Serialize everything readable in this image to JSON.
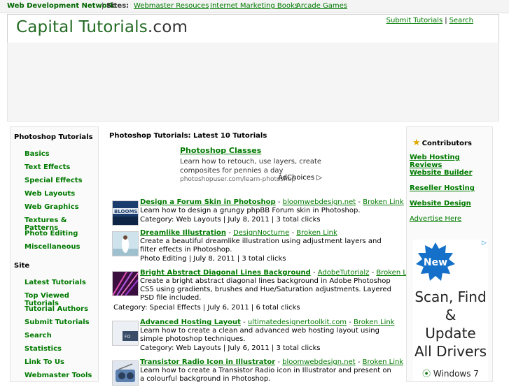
{
  "topbar": {
    "network": "Web Development Network",
    "separator": "|",
    "sites_label": "Sites:",
    "links": [
      "Webmaster Resouces",
      "Internet Marketing Books",
      "Arcade Games"
    ]
  },
  "header": {
    "logo_main": "Capital Tutorials",
    "logo_domain": ".com",
    "submit_link": "Submit Tutorials",
    "separator": "|",
    "search_link": "Search"
  },
  "left_sidebar": {
    "photoshop_heading": "Photoshop Tutorials",
    "photoshop_items": [
      "Basics",
      "Text Effects",
      "Special Effects",
      "Web Layouts",
      "Web Graphics",
      "Textures & Patterns",
      "Photo Editing",
      "Miscellaneous"
    ],
    "site_heading": "Site",
    "site_items": [
      "Latest Tutorials",
      "Top Viewed Tutorials",
      "Tutorial Authors",
      "Submit Tutorials",
      "Search",
      "Statistics",
      "Link To Us",
      "Webmaster Tools"
    ]
  },
  "main": {
    "title": "Photoshop Tutorials: Latest 10 Tutorials",
    "ad": {
      "title": "Photoshop Classes",
      "body": "Learn how to retouch, use layers, create composites for pennies a day",
      "url": "photoshopuser.com/learn-photoshop",
      "adchoices": "AdChoices"
    },
    "tutorials": [
      {
        "title": "Design a Forum Skin in Photoshop",
        "site": "bloomwebdesign.net",
        "broken": "Broken Link",
        "description": "Learn how to design a grungy phpBB Forum skin in Photoshop.",
        "meta": "Category: Web Layouts | July 8, 2011 | 3 total clicks",
        "thumb_color": "#1b3d6e"
      },
      {
        "title": "Dreamlike Illustration",
        "site": "DesignNocturne",
        "broken": "Broken Link",
        "description": "Create a beautiful dreamlike illustration using adjustment layers and filter effects in Photoshop.",
        "meta": "Photo Editing | July 8, 2011 | 3 total clicks",
        "thumb_color": "#b8d3e0"
      },
      {
        "title": "Bright Abstract Diagonal Lines Background",
        "site": "AdobeTutorialz",
        "broken": "Broken Link",
        "description": "Create a bright abstract diagonal lines background in Adobe Photoshop CS5 using gradients, brushes and Hue/Saturation adjustments. Layered PSD file included.",
        "meta": "Category: Special Effects | July 6, 2011 | 6 total clicks",
        "thumb_color": "#5a1f5e"
      },
      {
        "title": "Advanced Hosting Layout",
        "site": "ultimatedesignertoolkit.com",
        "broken": "Broken Link",
        "description": "Learn how to create a clean and advanced web hosting layout using simple photoshop techniques.",
        "meta": "Category: Web Layouts | July 6, 2011 | 3 total clicks",
        "thumb_color": "#d9dde3"
      },
      {
        "title": "Transistor Radio Icon in Illustrator",
        "site": "bloomwebdesign.net",
        "broken": "Broken Link",
        "description": "Learn how to create a Transistor Radio icon in Illustrator and present on a colourful background in Photoshop.",
        "meta": "",
        "thumb_color": "#8aa4c8"
      }
    ]
  },
  "right_sidebar": {
    "heading": "Contributors",
    "icon": "star-icon",
    "items": [
      "Web Hosting Reviews",
      "Website Builder",
      "Reseller Hosting",
      "Website Design"
    ],
    "advertise": "Advertise Here"
  },
  "right_ad": {
    "badge": "New",
    "lines": [
      "Scan, Find",
      "&",
      "Update",
      "All Drivers"
    ],
    "footer": "Windows 7"
  },
  "colors": {
    "link_green": "#007a00",
    "logo_green": "#226a22",
    "badge_blue": "#1470c8"
  }
}
